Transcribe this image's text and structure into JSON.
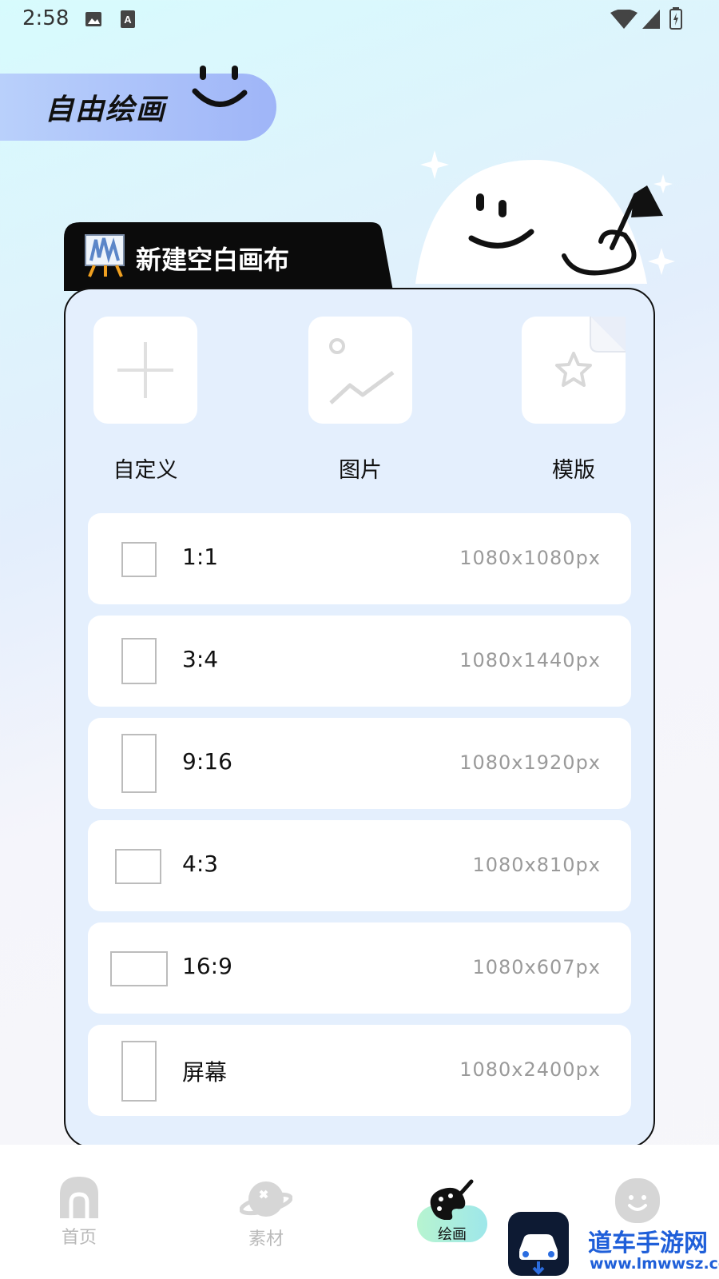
{
  "status_bar": {
    "time": "2:58"
  },
  "header": {
    "title": "自由绘画"
  },
  "canvas_panel": {
    "tab_title": "新建空白画布",
    "options": [
      {
        "label": "自定义",
        "icon": "plus-icon"
      },
      {
        "label": "图片",
        "icon": "image-icon"
      },
      {
        "label": "模版",
        "icon": "star-document-icon"
      }
    ],
    "ratios": [
      {
        "label": "1:1",
        "size": "1080x1080px"
      },
      {
        "label": "3:4",
        "size": "1080x1440px"
      },
      {
        "label": "9:16",
        "size": "1080x1920px"
      },
      {
        "label": "4:3",
        "size": "1080x810px"
      },
      {
        "label": "16:9",
        "size": "1080x607px"
      },
      {
        "label": "屏幕",
        "size": "1080x2400px"
      }
    ]
  },
  "bottom_nav": {
    "items": [
      {
        "label": "首页",
        "icon": "home-icon"
      },
      {
        "label": "素材",
        "icon": "planet-icon"
      },
      {
        "label": "绘画",
        "icon": "palette-icon",
        "active": true
      },
      {
        "label": "",
        "icon": "face-icon"
      }
    ]
  },
  "watermark": {
    "title": "道车手游网",
    "url": "www.lmwwsz.com"
  },
  "colors": {
    "accent": "#9fb5f8",
    "card_bg": "#e4effd",
    "active_nav": "#b7f4d0"
  }
}
